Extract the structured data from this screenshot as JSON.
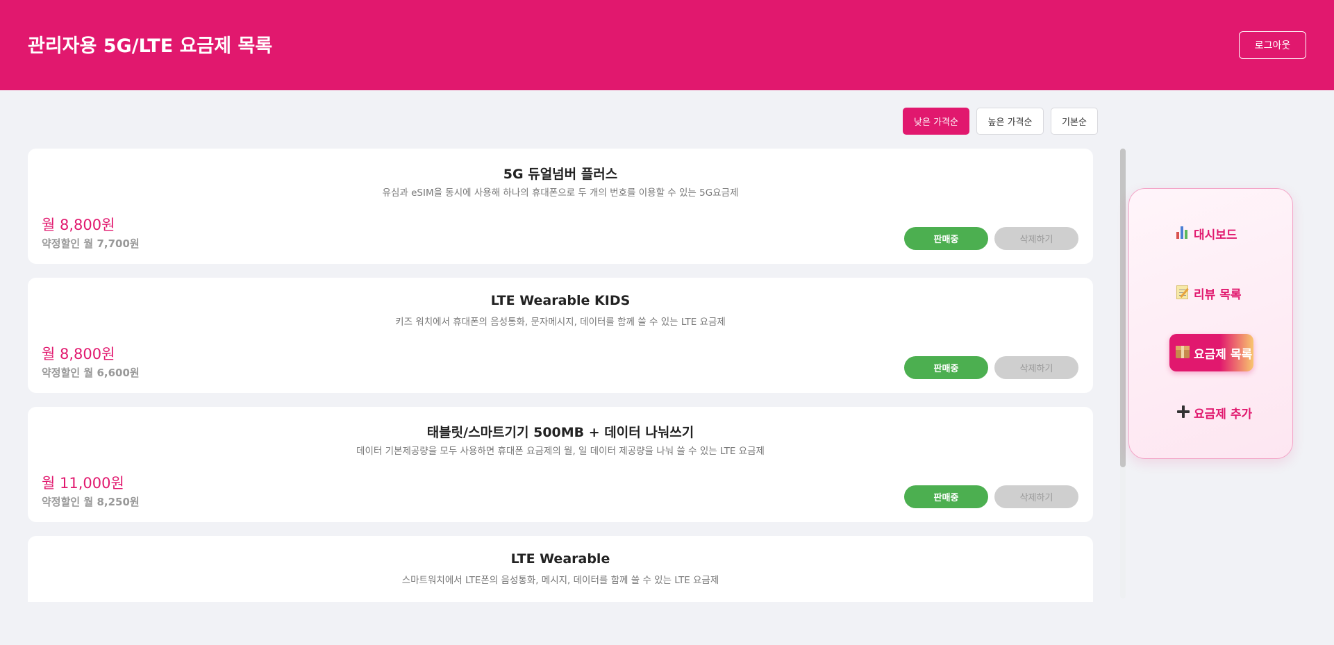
{
  "header": {
    "title": "관리자용 5G/LTE 요금제 목록",
    "logout_label": "로그아웃"
  },
  "sort": {
    "low_label": "낮은 가격순",
    "high_label": "높은 가격순",
    "default_label": "기본순",
    "active": "low"
  },
  "plans": [
    {
      "title": "5G 듀얼넘버 플러스",
      "description": "유심과 eSIM을 동시에 사용해 하나의 휴대폰으로 두 개의 번호를 이용할 수 있는 5G요금제",
      "price": "월 8,800원",
      "discount": "약정할인 월 7,700원",
      "status_label": "판매중",
      "delete_label": "삭제하기"
    },
    {
      "title": "LTE Wearable KIDS",
      "description": "키즈 워치에서 휴대폰의 음성통화, 문자메시지, 데이터를 함께 쓸 수 있는 LTE 요금제",
      "price": "월 8,800원",
      "discount": "약정할인 월 6,600원",
      "status_label": "판매중",
      "delete_label": "삭제하기"
    },
    {
      "title": "태블릿/스마트기기 500MB + 데이터 나눠쓰기",
      "description": "데이터 기본제공량을 모두 사용하면 휴대폰 요금제의 월, 일 데이터 제공량을 나눠 쓸 수 있는 LTE 요금제",
      "price": "월 11,000원",
      "discount": "약정할인 월 8,250원",
      "status_label": "판매중",
      "delete_label": "삭제하기"
    },
    {
      "title": "LTE Wearable",
      "description": "스마트워치에서 LTE폰의 음성통화, 메시지, 데이터를 함께 쓸 수 있는 LTE 요금제",
      "price": "",
      "discount": "",
      "status_label": "",
      "delete_label": ""
    }
  ],
  "sidebar": {
    "items": [
      {
        "icon": "bar-chart-icon",
        "label": "대시보드"
      },
      {
        "icon": "memo-icon",
        "label": "리뷰 목록"
      },
      {
        "icon": "package-icon",
        "label": "요금제 목록",
        "active": true
      },
      {
        "icon": "plus-icon",
        "label": "요금제 추가"
      }
    ]
  },
  "colors": {
    "brand": "#e1186e",
    "on_sale": "#4caf50",
    "delete_disabled": "#cfcfcf"
  }
}
